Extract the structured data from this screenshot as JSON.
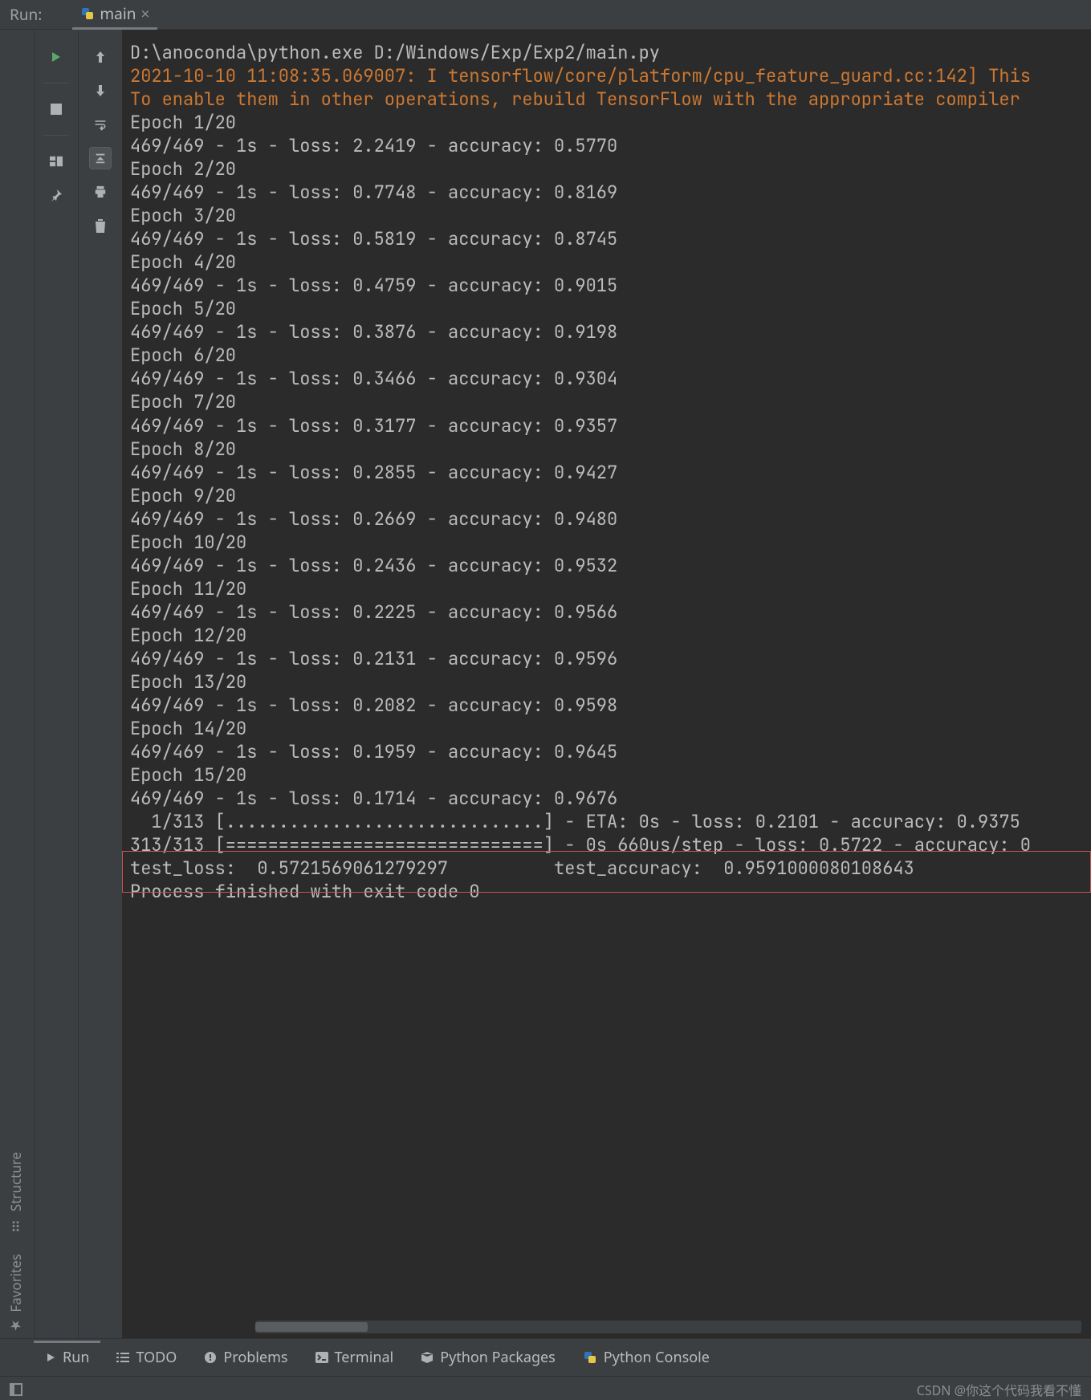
{
  "header": {
    "tool_title": "Run:",
    "tab_label": "main"
  },
  "console": {
    "command": "D:\\anoconda\\python.exe D:/Windows/Exp/Exp2/main.py",
    "warning_lines": [
      "2021-10-10 11:08:35.069007: I tensorflow/core/platform/cpu_feature_guard.cc:142] This",
      "To enable them in other operations, rebuild TensorFlow with the appropriate compiler "
    ],
    "epochs": [
      {
        "label": "Epoch 1/20",
        "metrics": "469/469 - 1s - loss: 2.2419 - accuracy: 0.5770"
      },
      {
        "label": "Epoch 2/20",
        "metrics": "469/469 - 1s - loss: 0.7748 - accuracy: 0.8169"
      },
      {
        "label": "Epoch 3/20",
        "metrics": "469/469 - 1s - loss: 0.5819 - accuracy: 0.8745"
      },
      {
        "label": "Epoch 4/20",
        "metrics": "469/469 - 1s - loss: 0.4759 - accuracy: 0.9015"
      },
      {
        "label": "Epoch 5/20",
        "metrics": "469/469 - 1s - loss: 0.3876 - accuracy: 0.9198"
      },
      {
        "label": "Epoch 6/20",
        "metrics": "469/469 - 1s - loss: 0.3466 - accuracy: 0.9304"
      },
      {
        "label": "Epoch 7/20",
        "metrics": "469/469 - 1s - loss: 0.3177 - accuracy: 0.9357"
      },
      {
        "label": "Epoch 8/20",
        "metrics": "469/469 - 1s - loss: 0.2855 - accuracy: 0.9427"
      },
      {
        "label": "Epoch 9/20",
        "metrics": "469/469 - 1s - loss: 0.2669 - accuracy: 0.9480"
      },
      {
        "label": "Epoch 10/20",
        "metrics": "469/469 - 1s - loss: 0.2436 - accuracy: 0.9532"
      },
      {
        "label": "Epoch 11/20",
        "metrics": "469/469 - 1s - loss: 0.2225 - accuracy: 0.9566"
      },
      {
        "label": "Epoch 12/20",
        "metrics": "469/469 - 1s - loss: 0.2131 - accuracy: 0.9596"
      },
      {
        "label": "Epoch 13/20",
        "metrics": "469/469 - 1s - loss: 0.2082 - accuracy: 0.9598"
      },
      {
        "label": "Epoch 14/20",
        "metrics": "469/469 - 1s - loss: 0.1959 - accuracy: 0.9645"
      },
      {
        "label": "Epoch 15/20",
        "metrics": "469/469 - 1s - loss: 0.1714 - accuracy: 0.9676"
      }
    ],
    "progress_partial": "  1/313 [..............................] - ETA: 0s - loss: 0.2101 - accuracy: 0.9375",
    "progress_done": "313/313 [==============================] - 0s 660us/step - loss: 0.5722 - accuracy: 0",
    "result_line": "test_loss:  0.5721569061279297          test_accuracy:  0.9591000080108643",
    "exit_line": "Process finished with exit code 0"
  },
  "bottom_tools": {
    "run": "Run",
    "todo": "TODO",
    "problems": "Problems",
    "terminal": "Terminal",
    "pypkg": "Python Packages",
    "pyconsole": "Python Console"
  },
  "side_tabs": {
    "structure": "Structure",
    "favorites": "Favorites"
  },
  "watermark": "CSDN @你这个代码我看不懂"
}
